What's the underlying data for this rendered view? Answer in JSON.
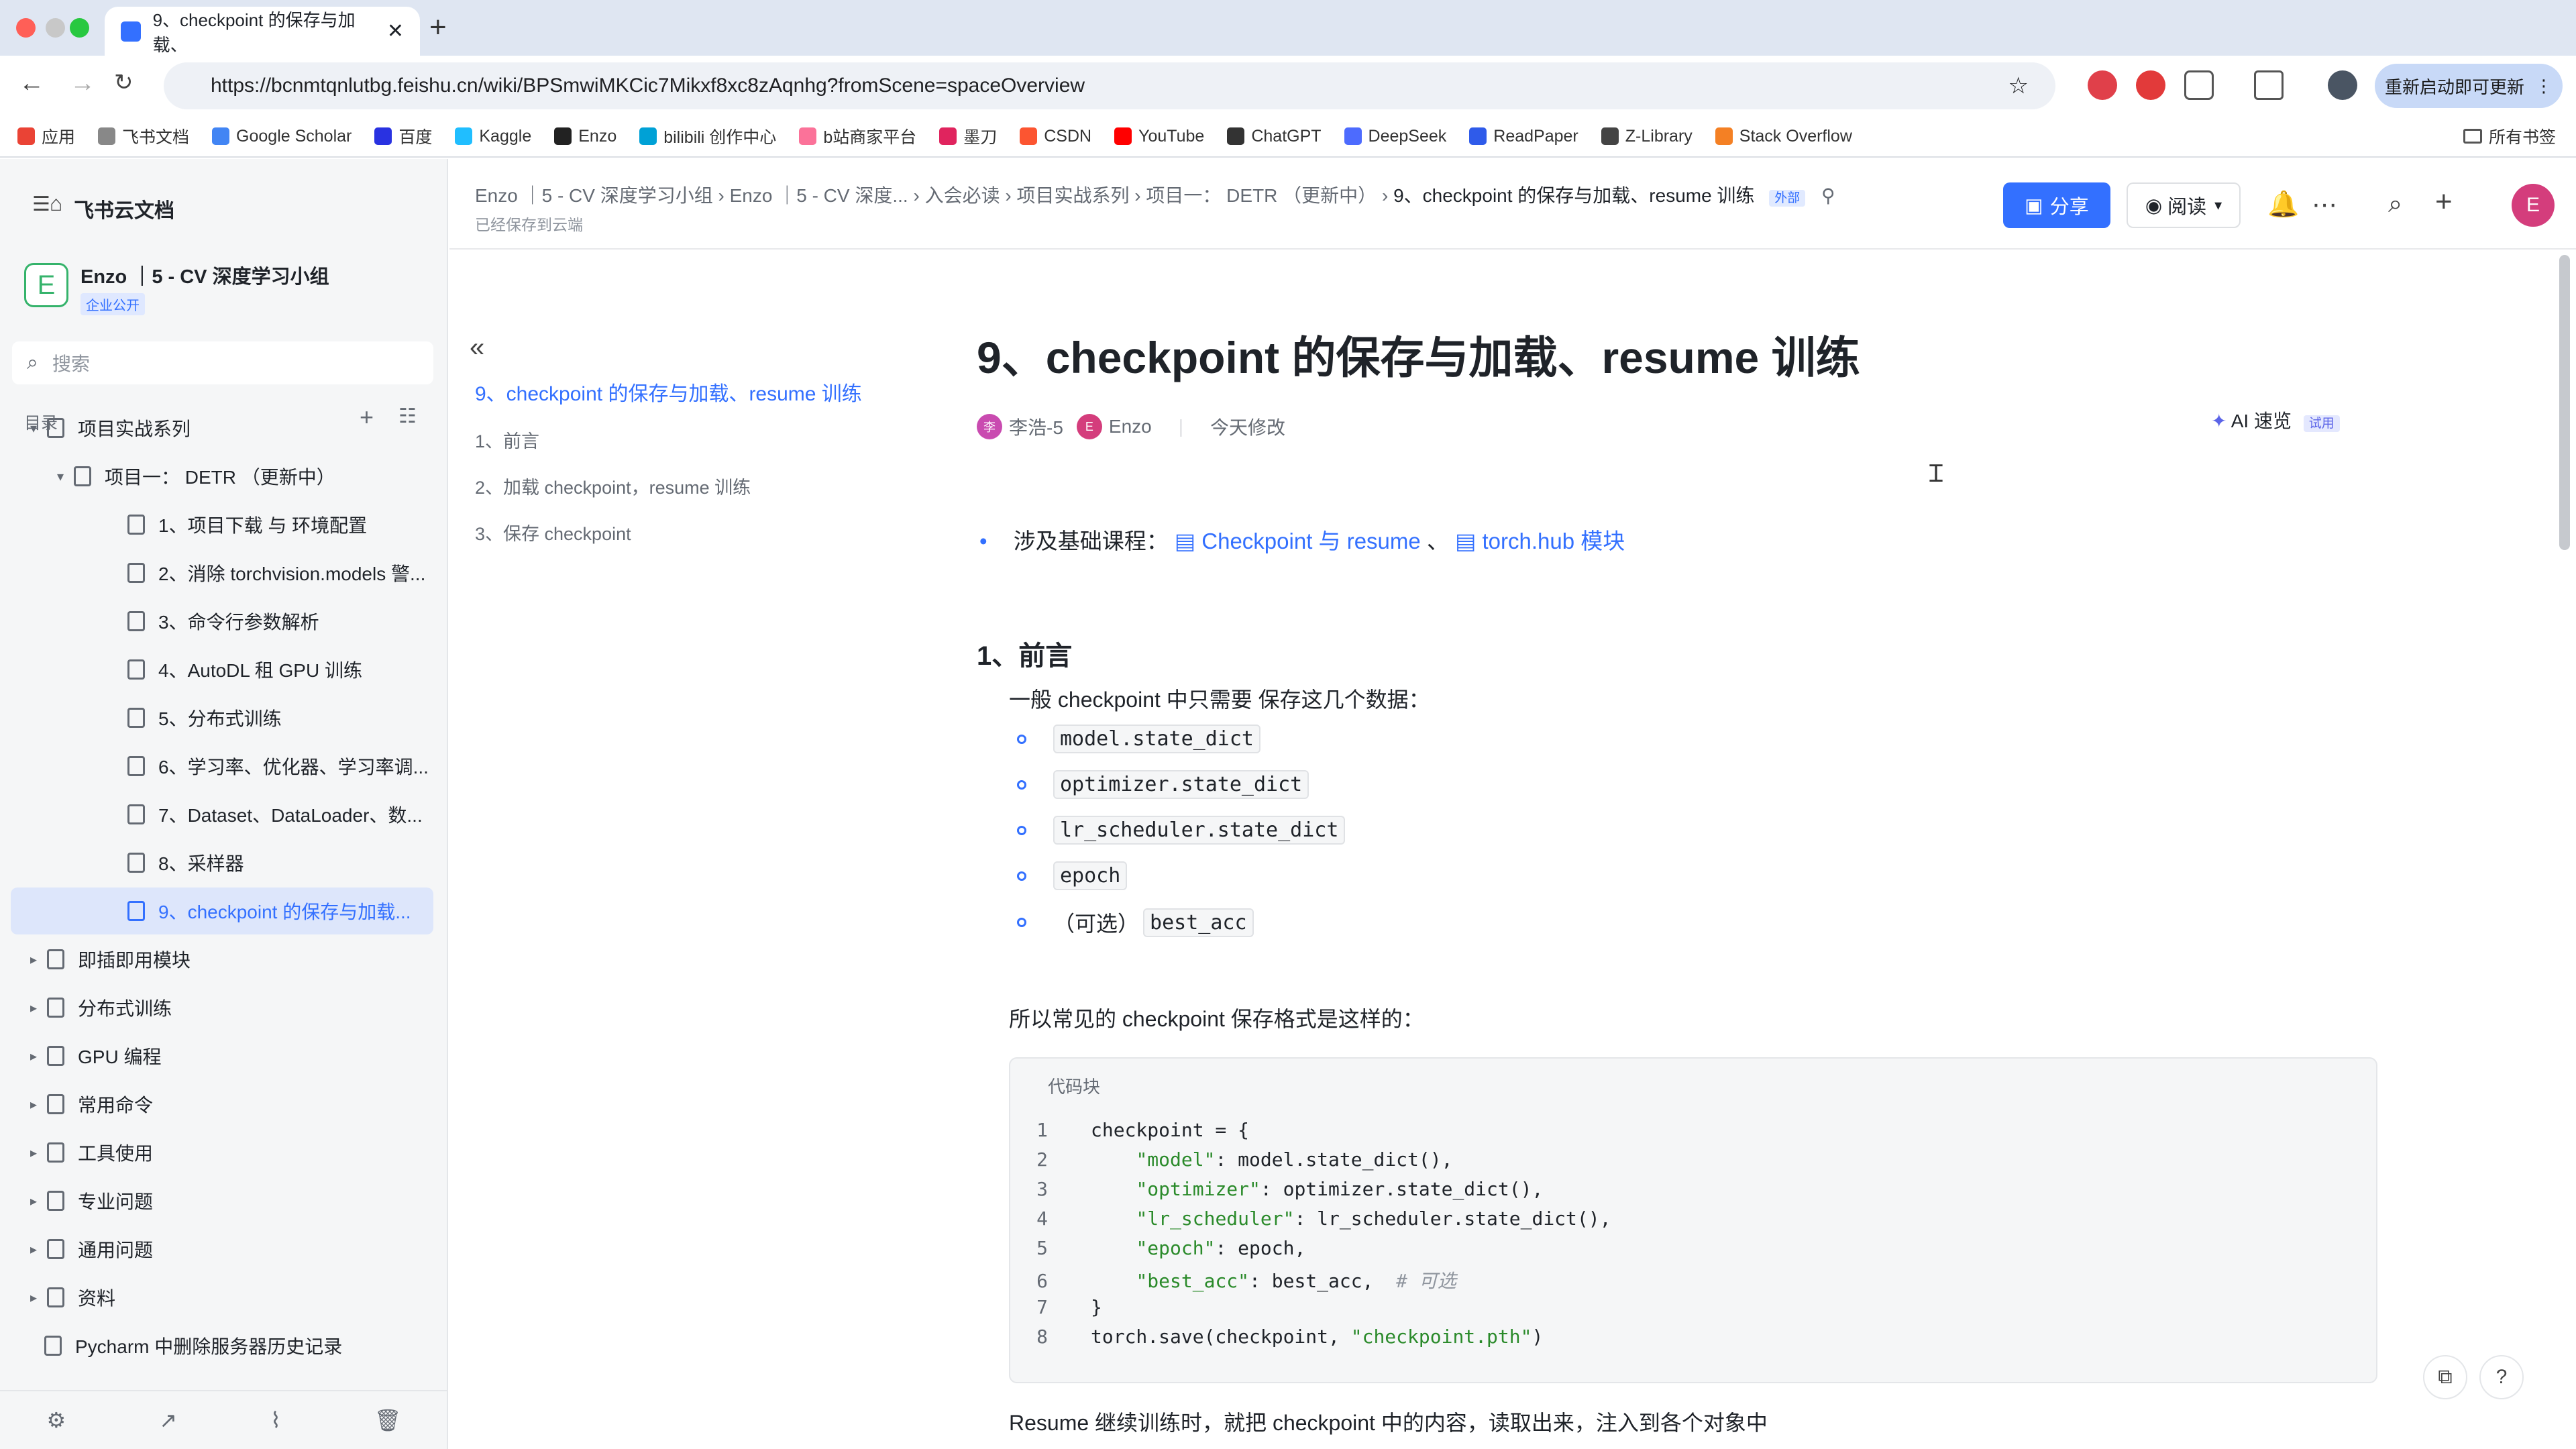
{
  "browser": {
    "tab_title": "9、checkpoint 的保存与加载、",
    "tab_close": "✕",
    "new_tab": "+",
    "url": "https://bcnmtqnlutbg.feishu.cn/wiki/BPSmwiMKCic7Mikxf8xc8zAqnhg?fromScene=spaceOverview",
    "relaunch": "重新启动即可更新",
    "bookmarks": [
      {
        "label": "应用",
        "icon": "apps-grid-icon",
        "color": "#ea4335"
      },
      {
        "label": "飞书文档",
        "icon": "folder-icon",
        "color": "#888888"
      },
      {
        "label": "Google Scholar",
        "icon": "scholar-icon",
        "color": "#4285f4"
      },
      {
        "label": "百度",
        "icon": "baidu-icon",
        "color": "#2932e1"
      },
      {
        "label": "Kaggle",
        "icon": "kaggle-icon",
        "color": "#20beff"
      },
      {
        "label": "Enzo",
        "icon": "github-icon",
        "color": "#222222"
      },
      {
        "label": "bilibili 创作中心",
        "icon": "bilibili-icon",
        "color": "#00a1d6"
      },
      {
        "label": "b站商家平台",
        "icon": "bilibili-shop-icon",
        "color": "#fb7299"
      },
      {
        "label": "墨刀",
        "icon": "modao-icon",
        "color": "#e0245e"
      },
      {
        "label": "CSDN",
        "icon": "csdn-icon",
        "color": "#fc5531"
      },
      {
        "label": "YouTube",
        "icon": "youtube-icon",
        "color": "#ff0000"
      },
      {
        "label": "ChatGPT",
        "icon": "chatgpt-icon",
        "color": "#333333"
      },
      {
        "label": "DeepSeek",
        "icon": "deepseek-icon",
        "color": "#4d6bfe"
      },
      {
        "label": "ReadPaper",
        "icon": "readpaper-icon",
        "color": "#2f5bea"
      },
      {
        "label": "Z-Library",
        "icon": "zlibrary-icon",
        "color": "#444444"
      },
      {
        "label": "Stack Overflow",
        "icon": "stackoverflow-icon",
        "color": "#f48024"
      }
    ],
    "all_bookmarks": "所有书签"
  },
  "sidebar": {
    "title": "飞书云文档",
    "workspace_initial": "E",
    "workspace_name": "Enzo ｜5 - CV 深度学习小组",
    "workspace_badge": "企业公开",
    "search_placeholder": "搜索",
    "toc_label": "目录",
    "items": [
      {
        "label": "项目实战系列",
        "arrow": "▾"
      },
      {
        "label": "项目一： DETR （更新中）",
        "arrow": "▾"
      },
      {
        "label": "1、项目下载 与 环境配置"
      },
      {
        "label": "2、消除 torchvision.models 警..."
      },
      {
        "label": "3、命令行参数解析"
      },
      {
        "label": "4、AutoDL 租 GPU 训练"
      },
      {
        "label": "5、分布式训练"
      },
      {
        "label": "6、学习率、优化器、学习率调..."
      },
      {
        "label": "7、Dataset、DataLoader、数..."
      },
      {
        "label": "8、采样器"
      },
      {
        "label": "9、checkpoint 的保存与加载..."
      },
      {
        "label": "即插即用模块",
        "arrow": "▸"
      },
      {
        "label": "分布式训练",
        "arrow": "▸"
      },
      {
        "label": "GPU 编程",
        "arrow": "▸"
      },
      {
        "label": "常用命令",
        "arrow": "▸"
      },
      {
        "label": "工具使用",
        "arrow": "▸"
      },
      {
        "label": "专业问题",
        "arrow": "▸"
      },
      {
        "label": "通用问题",
        "arrow": "▸"
      },
      {
        "label": "资料",
        "arrow": "▸"
      },
      {
        "label": "Pycharm 中删除服务器历史记录"
      }
    ]
  },
  "header": {
    "breadcrumbs": [
      "Enzo ｜5 - CV 深度学习小组",
      "Enzo ｜5 - CV 深度...",
      "入会必读",
      "项目实战系列",
      "项目一： DETR （更新中）",
      "9、checkpoint 的保存与加载、resume 训练"
    ],
    "external_badge": "外部",
    "saved_status": "已经保存到云端",
    "share_label": "分享",
    "read_label": "阅读",
    "avatar_initial": "E"
  },
  "outline": {
    "items": [
      "9、checkpoint 的保存与加载、resume 训练",
      "1、前言",
      "2、加载 checkpoint，resume 训练",
      "3、保存 checkpoint"
    ]
  },
  "doc": {
    "title": "9、checkpoint 的保存与加载、resume 训练",
    "author1_initial": "李",
    "author1": "李浩-5",
    "author2_initial": "E",
    "author2": "Enzo",
    "modified": "今天修改",
    "ai_label": "AI 速览",
    "ai_trial": "试用",
    "course_prefix": "涉及基础课程：",
    "course_link1": "Checkpoint 与 resume",
    "course_sep": "、",
    "course_link2": "torch.hub 模块",
    "section1": "1、前言",
    "intro": "一般 checkpoint 中只需要 保存这几个数据：",
    "list": [
      "model.state_dict",
      "optimizer.state_dict",
      "lr_scheduler.state_dict",
      "epoch"
    ],
    "optional_prefix": "（可选）",
    "optional_item": "best_acc",
    "format_text": "所以常见的 checkpoint 保存格式是这样的：",
    "code_label": "代码块",
    "code": [
      {
        "n": "1",
        "pre": "checkpoint = {",
        "str": "",
        "post": "",
        "cmt": ""
      },
      {
        "n": "2",
        "pre": "    ",
        "str": "\"model\"",
        "post": ": model.state_dict(),",
        "cmt": ""
      },
      {
        "n": "3",
        "pre": "    ",
        "str": "\"optimizer\"",
        "post": ": optimizer.state_dict(),",
        "cmt": ""
      },
      {
        "n": "4",
        "pre": "    ",
        "str": "\"lr_scheduler\"",
        "post": ": lr_scheduler.state_dict(),",
        "cmt": ""
      },
      {
        "n": "5",
        "pre": "    ",
        "str": "\"epoch\"",
        "post": ": epoch,",
        "cmt": ""
      },
      {
        "n": "6",
        "pre": "    ",
        "str": "\"best_acc\"",
        "post": ": best_acc,  ",
        "cmt": "# 可选"
      },
      {
        "n": "7",
        "pre": "}",
        "str": "",
        "post": "",
        "cmt": ""
      },
      {
        "n": "8",
        "pre": "torch.save(checkpoint, ",
        "str": "\"checkpoint.pth\"",
        "post": ")",
        "cmt": ""
      }
    ],
    "resume_text": "Resume 继续训练时，就把 checkpoint 中的内容，读取出来，注入到各个对象中"
  }
}
